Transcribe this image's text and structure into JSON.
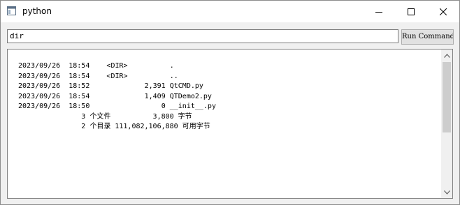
{
  "window": {
    "title": "python",
    "icon": "python-app-icon",
    "controls": [
      "minimize-icon",
      "maximize-icon",
      "close-icon"
    ]
  },
  "command": {
    "value": "dir",
    "run_label": "Run Command"
  },
  "output": {
    "lines": [
      "2023/09/26  18:54    <DIR>          .",
      "2023/09/26  18:54    <DIR>          ..",
      "2023/09/26  18:52             2,391 QtCMD.py",
      "2023/09/26  18:54             1,409 QTDemo2.py",
      "2023/09/26  18:50                 0 __init__.py",
      "               3 个文件          3,800 字节",
      "               2 个目录 111,082,106,880 可用字节"
    ]
  },
  "scrollbar": {
    "up_icon": "scroll-up-arrow-icon",
    "down_icon": "scroll-down-arrow-icon"
  }
}
